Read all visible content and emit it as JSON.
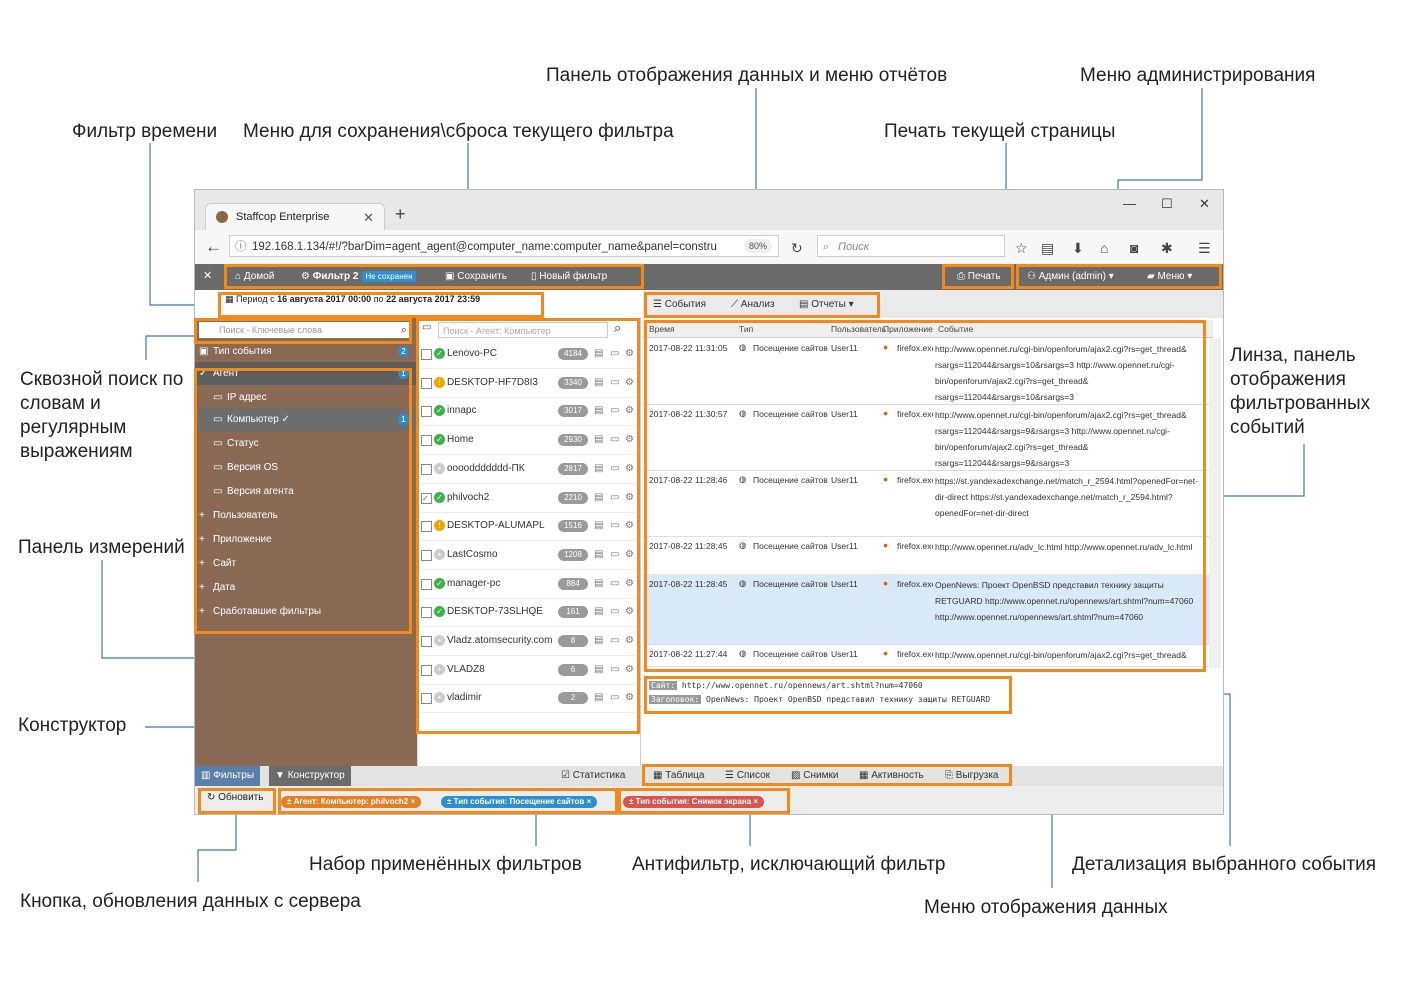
{
  "annotations": {
    "time_filter": "Фильтр времени",
    "save_reset_menu": "Меню для сохранения\\сброса текущего фильтра",
    "data_panel_reports": "Панель отображения данных и меню отчётов",
    "admin_menu": "Меню администрирования",
    "print_page": "Печать текущей страницы",
    "fulltext_search": "Сквозной поиск по словам и регулярным выражениям",
    "dimensions_panel": "Панель измерений",
    "constructor": "Конструктор",
    "lens": "Линза, панель отображения фильтрованных событий",
    "applied_filters": "Набор применённых фильтров",
    "antifilter": "Антифильтр, исключающий фильтр",
    "event_detail": "Детализация выбранного события",
    "refresh_button": "Кнопка, обновления данных с сервера",
    "data_display_menu": "Меню отображения данных"
  },
  "browser": {
    "tab_title": "Staffcop Enterprise",
    "url": "192.168.1.134/#!/?barDim=agent_agent@computer_name:computer_name&panel=constru",
    "zoom": "80%",
    "search_placeholder": "Поиск"
  },
  "app": {
    "nav": {
      "home": "Домой",
      "filter": "Фильтр 2",
      "not_saved": "Не сохранен",
      "save": "Сохранить",
      "new_filter": "Новый фильтр",
      "print": "Печать",
      "admin": "Админ (admin)",
      "menu": "Меню"
    },
    "period": {
      "prefix": "Период с",
      "from": "16 августа 2017 00:00",
      "to_word": "по",
      "to": "22 августа 2017 23:59"
    },
    "search_placeholder": "Поиск - Ключевые слова",
    "dimensions": [
      {
        "label": "Тип события",
        "count": "2"
      },
      {
        "label": "Агент",
        "count": "1"
      },
      {
        "label": "IP адрес"
      },
      {
        "label": "Компьютер ✓",
        "count": "1"
      },
      {
        "label": "Статус"
      },
      {
        "label": "Версия OS"
      },
      {
        "label": "Версия агента"
      },
      {
        "label": "Пользователь"
      },
      {
        "label": "Приложение"
      },
      {
        "label": "Сайт"
      },
      {
        "label": "Дата"
      },
      {
        "label": "Сработавшие фильтры"
      }
    ],
    "agent_search_placeholder": "Поиск - Агент: Компьютер",
    "agents": [
      {
        "name": "Lenovo-PC",
        "count": "4184",
        "status": "ok",
        "checked": false
      },
      {
        "name": "DESKTOP-HF7D8I3",
        "count": "3340",
        "status": "warn",
        "checked": false
      },
      {
        "name": "innapc",
        "count": "3017",
        "status": "ok",
        "checked": false
      },
      {
        "name": "Home",
        "count": "2930",
        "status": "ok",
        "checked": false
      },
      {
        "name": "ooooddddddd-ПК",
        "count": "2817",
        "status": "off",
        "checked": false
      },
      {
        "name": "philvoch2",
        "count": "2210",
        "status": "ok",
        "checked": true
      },
      {
        "name": "DESKTOP-ALUMAPL",
        "count": "1516",
        "status": "warn",
        "checked": false
      },
      {
        "name": "LastCosmo",
        "count": "1208",
        "status": "off",
        "checked": false
      },
      {
        "name": "manager-pc",
        "count": "884",
        "status": "ok",
        "checked": false
      },
      {
        "name": "DESKTOP-73SLHQE",
        "count": "161",
        "status": "ok",
        "checked": false
      },
      {
        "name": "Vladz.atomsecurity.com",
        "count": "8",
        "status": "off",
        "checked": false
      },
      {
        "name": "VLADZ8",
        "count": "6",
        "status": "off",
        "checked": false
      },
      {
        "name": "vladimir",
        "count": "2",
        "status": "off",
        "checked": false
      }
    ],
    "view_tabs": {
      "events": "События",
      "analysis": "Анализ",
      "reports": "Отчеты"
    },
    "columns": {
      "time": "Время",
      "type": "Тип",
      "user": "Пользователь",
      "app": "Приложение",
      "event": "Событие"
    },
    "events": [
      {
        "time": "2017-08-22 11:31:05",
        "type": "Посещение сайтов",
        "user": "User11",
        "app": "firefox.exe",
        "text": "http://www.opennet.ru/cgi-bin/openforum/ajax2.cgi?rs=get_thread& rsargs=112044&rsargs=10&rsargs=3 http://www.opennet.ru/cgi-bin/openforum/ajax2.cgi?rs=get_thread& rsargs=112044&rsargs=10&rsargs=3"
      },
      {
        "time": "2017-08-22 11:30:57",
        "type": "Посещение сайтов",
        "user": "User11",
        "app": "firefox.exe",
        "text": "http://www.opennet.ru/cgi-bin/openforum/ajax2.cgi?rs=get_thread& rsargs=112044&rsargs=9&rsargs=3 http://www.opennet.ru/cgi-bin/openforum/ajax2.cgi?rs=get_thread& rsargs=112044&rsargs=9&rsargs=3"
      },
      {
        "time": "2017-08-22 11:28:46",
        "type": "Посещение сайтов",
        "user": "User11",
        "app": "firefox.exe",
        "text": "https://st.yandexadexchange.net/match_r_2594.html?openedFor=net-dir-direct https://st.yandexadexchange.net/match_r_2594.html?openedFor=net-dir-direct"
      },
      {
        "time": "2017-08-22 11:28:45",
        "type": "Посещение сайтов",
        "user": "User11",
        "app": "firefox.exe",
        "text": "http://www.opennet.ru/adv_lc.html http://www.opennet.ru/adv_lc.html"
      },
      {
        "time": "2017-08-22 11:28:45",
        "type": "Посещение сайтов",
        "user": "User11",
        "app": "firefox.exe",
        "text": "OpenNews: Проект OpenBSD представил технику защиты RETGUARD http://www.opennet.ru/opennews/art.shtml?num=47060 http://www.opennet.ru/opennews/art.shtml?num=47060"
      },
      {
        "time": "2017-08-22 11:27:44",
        "type": "Посещение сайтов",
        "user": "User11",
        "app": "firefox.exe",
        "text": "http://www.opennet.ru/cgi-bin/openforum/ajax2.cgi?rs=get_thread&"
      }
    ],
    "detail": {
      "site_label": "Сайт:",
      "site": "http://www.opennet.ru/opennews/art.shtml?num=47060",
      "title_label": "Заголовок:",
      "title": "OpenNews: Проект OpenBSD представил технику защиты RETGUARD"
    },
    "left_tabs": {
      "filters": "Фильтры",
      "constructor": "Конструктор"
    },
    "statistics": "Статистика",
    "data_views": {
      "table": "Таблица",
      "list": "Список",
      "shots": "Снимки",
      "activity": "Активность",
      "export": "Выгрузка"
    },
    "refresh": "Обновить",
    "chips": [
      {
        "text": "± Агент: Компьютер: philvoch2 ×",
        "color": "#e67e22"
      },
      {
        "text": "± Тип события: Посещение сайтов ×",
        "color": "#2f8ecf"
      },
      {
        "text": "± Тип события: Снимок экрана ×",
        "color": "#d9534f"
      }
    ]
  }
}
